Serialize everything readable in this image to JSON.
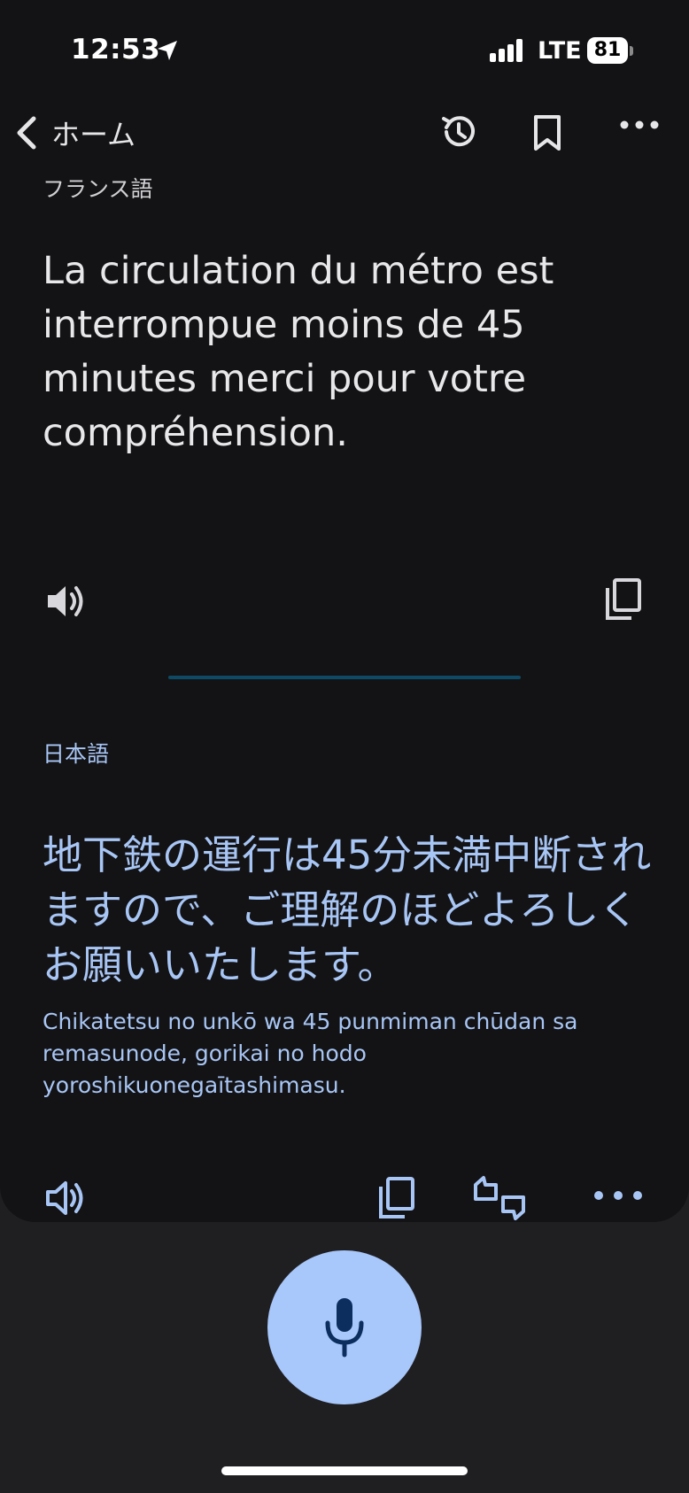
{
  "status_bar": {
    "time": "12:53",
    "network": "LTE",
    "battery": "81"
  },
  "nav": {
    "back_label": "ホーム"
  },
  "source": {
    "language": "フランス語",
    "text": "La circulation du métro est interrompue moins de 45 minutes merci pour votre compréhension."
  },
  "target": {
    "language": "日本語",
    "text": "地下鉄の運行は45分未満中断されますので、ご理解のほどよろしくお願いいたします。",
    "romanization": "Chikatetsu no unkō wa 45 punmiman chūdan sa remasunode, gorikai no hodo yoroshikuonegaītashimasu."
  },
  "icons": {
    "back": "chevron-left-icon",
    "history": "history-icon",
    "bookmark": "bookmark-icon",
    "more": "more-horizontal-icon",
    "speaker": "speaker-icon",
    "copy": "copy-icon",
    "feedback": "feedback-icon",
    "mic": "mic-icon"
  },
  "colors": {
    "background": "#131315",
    "accent": "#a8c6f5",
    "mic_button": "#a8c7fa",
    "divider": "#0e4a66"
  }
}
